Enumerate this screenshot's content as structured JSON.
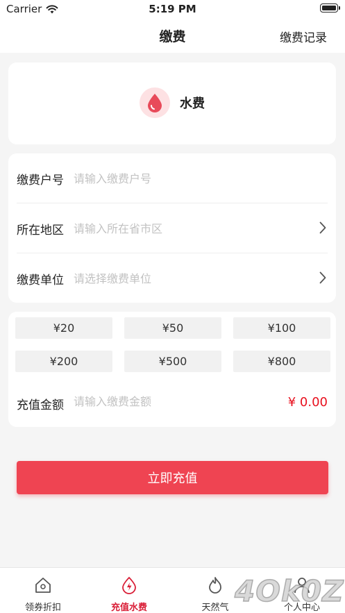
{
  "status_bar": {
    "carrier": "Carrier",
    "time": "5:19 PM"
  },
  "nav": {
    "title": "缴费",
    "right_action": "缴费记录"
  },
  "service": {
    "name": "水费",
    "icon": "water-drop-icon",
    "icon_bg": "#fde1e3",
    "icon_color": "#e84a5a"
  },
  "form": {
    "account": {
      "label": "缴费户号",
      "placeholder": "请输入缴费户号",
      "value": ""
    },
    "region": {
      "label": "所在地区",
      "placeholder": "请输入所在省市区",
      "value": ""
    },
    "unit": {
      "label": "缴费单位",
      "placeholder": "请选择缴费单位",
      "value": ""
    }
  },
  "amounts": {
    "options": [
      "¥20",
      "¥50",
      "¥100",
      "¥200",
      "¥500",
      "¥800"
    ],
    "label": "充值金额",
    "placeholder": "请输入缴费金额",
    "value": "",
    "total": "¥ 0.00"
  },
  "submit_label": "立即充值",
  "tabs": [
    {
      "label": "领券折扣",
      "icon": "home-icon",
      "active": false
    },
    {
      "label": "充值水费",
      "icon": "bolt-circle-icon",
      "active": true
    },
    {
      "label": "天然气",
      "icon": "flame-icon",
      "active": false
    },
    {
      "label": "个人中心",
      "icon": "person-icon",
      "active": false
    }
  ],
  "watermark": "4Ok0Z",
  "colors": {
    "accent": "#ef4452",
    "active_tab": "#d91d36",
    "price": "#e8101e",
    "background": "#f5f5f5"
  }
}
